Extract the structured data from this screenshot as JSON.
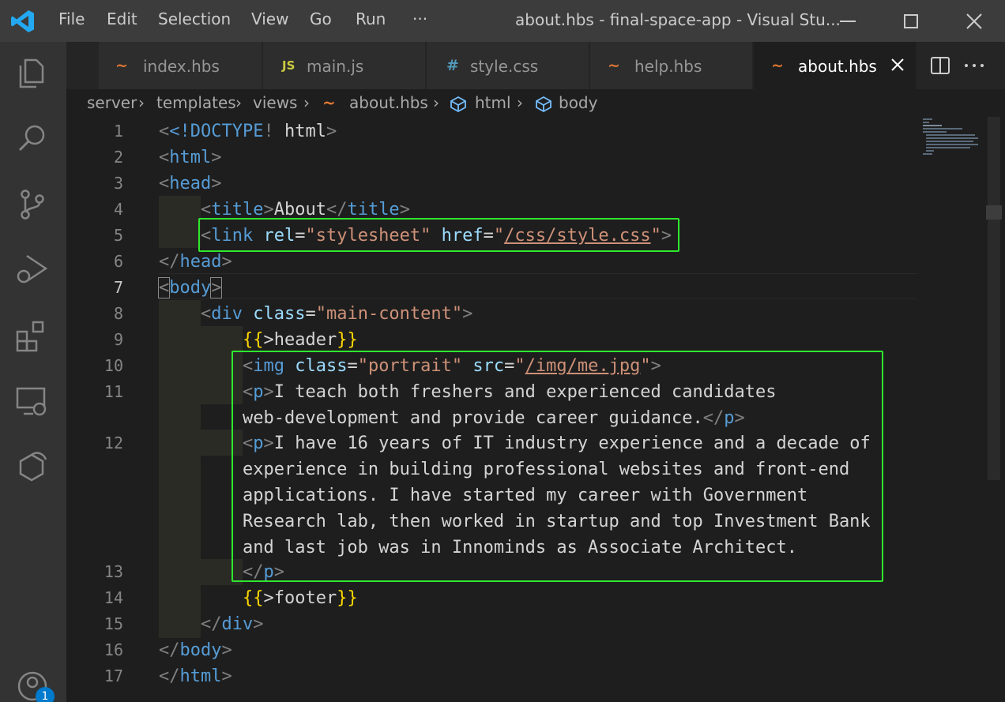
{
  "titlebar": {
    "menu": [
      "File",
      "Edit",
      "Selection",
      "View",
      "Go",
      "Run",
      "···"
    ],
    "title": "about.hbs - final-space-app - Visual Stu..."
  },
  "tabs": [
    {
      "icon": "~",
      "label": "index.hbs",
      "icon_color": "#e37933"
    },
    {
      "icon": "JS",
      "label": "main.js",
      "icon_color": "#cbcb41"
    },
    {
      "icon": "#",
      "label": "style.css",
      "icon_color": "#519aba"
    },
    {
      "icon": "~",
      "label": "help.hbs",
      "icon_color": "#e37933"
    },
    {
      "icon": "~",
      "label": "about.hbs",
      "icon_color": "#e37933",
      "active": true
    }
  ],
  "breadcrumb": [
    "server",
    "templates",
    "views",
    "about.hbs",
    "html",
    "body"
  ],
  "editor": {
    "line_numbers": [
      "1",
      "2",
      "3",
      "4",
      "5",
      "6",
      "7",
      "8",
      "9",
      "10",
      "11",
      "12",
      "13",
      "14",
      "15",
      "16",
      "17"
    ],
    "current_line": "7",
    "code": {
      "l1_doctype": "<!DOCTYPE",
      "l1_html": "html",
      "l4_title_text": "About",
      "l5_rel": "\"stylesheet\"",
      "l5_href": "/css/style.css",
      "l8_class": "\"main-content\"",
      "l9_partial": "header",
      "l10_class": "\"portrait\"",
      "l10_src": "/img/me.jpg",
      "l11_text_a": "I teach both freshers and experienced candidates",
      "l11_text_b": "web-development and provide career guidance.",
      "l12_text_a": "I have 16 years of IT industry experience and a decade of",
      "l12_text_b": "experience in building professional websites and front-end",
      "l12_text_c": "applications. I have started my career with Government",
      "l12_text_d": "Research lab, then worked in startup and top Investment Bank",
      "l12_text_e": "and last job was in Innominds as Associate Architect.",
      "l14_partial": "footer"
    }
  },
  "activity_badge": "1",
  "colors": {
    "highlight_box": "#2ee82e",
    "tag": "#569cd6",
    "attribute": "#9cdcfe",
    "string": "#ce9178",
    "brace": "#ffd700"
  }
}
